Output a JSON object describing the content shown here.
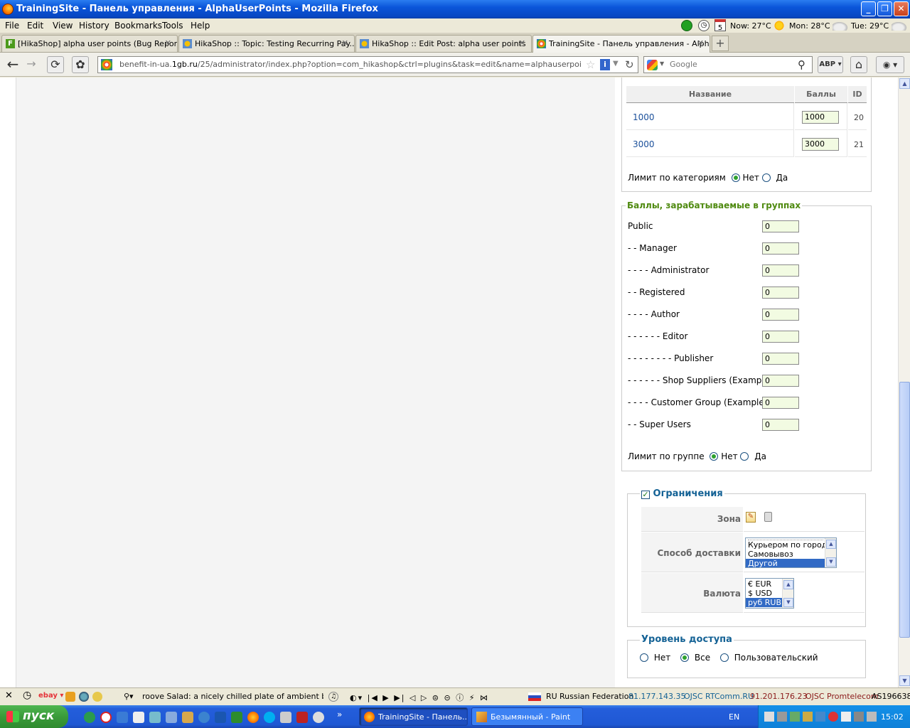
{
  "window": {
    "title": "TrainingSite - Панель управления - AlphaUserPoints - Mozilla Firefox"
  },
  "menu": {
    "items": [
      "File",
      "Edit",
      "View",
      "History",
      "Bookmarks",
      "Tools",
      "Help"
    ]
  },
  "weather": {
    "now": "Now: 27°C",
    "mon": "Mon: 28°C",
    "tue": "Tue: 29°C",
    "calendar_day": "5"
  },
  "tabs": [
    {
      "label": "[HikaShop] alpha user points (Bug Report)",
      "active": false
    },
    {
      "label": "HikaShop :: Topic: Testing Recurring Pay...",
      "active": false
    },
    {
      "label": "HikaShop :: Edit Post: alpha user points",
      "active": false
    },
    {
      "label": "TrainingSite - Панель управления - Alph...",
      "active": true
    }
  ],
  "nav": {
    "url_host": "benefit-in-ua.1gb.ru",
    "url_prefix": "benefit-in-ua.",
    "url_domain": "1gb.ru",
    "url_path": "/25/administrator/index.php?option=com_hikashop&ctrl=plugins&task=edit&name=alphauserpoints&plugin_type=p",
    "search_placeholder": "Google"
  },
  "points_table": {
    "col_name": "Название",
    "col_points": "Баллы",
    "col_id": "ID",
    "rows": [
      {
        "name": "1000",
        "points": "1000",
        "id": "20"
      },
      {
        "name": "3000",
        "points": "3000",
        "id": "21"
      }
    ],
    "limit_label": "Лимит по категориям",
    "limit_no": "Нет",
    "limit_yes": "Да"
  },
  "groups": {
    "legend": "Баллы, зарабатываемые в группах",
    "rows": [
      {
        "label": "Public",
        "value": "0"
      },
      {
        "label": "- - Manager",
        "value": "0"
      },
      {
        "label": "- - - - Administrator",
        "value": "0"
      },
      {
        "label": "- - Registered",
        "value": "0"
      },
      {
        "label": "- - - - Author",
        "value": "0"
      },
      {
        "label": "- - - - - - Editor",
        "value": "0"
      },
      {
        "label": "- - - - - - - - Publisher",
        "value": "0"
      },
      {
        "label": "- - - - - - Shop Suppliers (Example)",
        "value": "0"
      },
      {
        "label": "- - - - Customer Group (Example)",
        "value": "0"
      },
      {
        "label": "- - Super Users",
        "value": "0"
      }
    ],
    "limit_label": "Лимит по группе",
    "limit_no": "Нет",
    "limit_yes": "Да"
  },
  "restrictions": {
    "legend": "Ограничения",
    "zone_label": "Зона",
    "shipping_label": "Способ доставки",
    "shipping_options": [
      "Курьером по городу",
      "Самовывоз",
      "Другой"
    ],
    "shipping_selected": "Другой",
    "currency_label": "Валюта",
    "currency_options": [
      "€ EUR",
      "$ USD",
      "руб RUB"
    ],
    "currency_selected": "руб RUB"
  },
  "access": {
    "legend": "Уровень доступа",
    "opt_none": "Нет",
    "opt_all": "Все",
    "opt_custom": "Пользовательский",
    "selected": "Все"
  },
  "statusbar": {
    "ticker": "roove Salad: a nicely chilled plate of ambient beats a",
    "country_code": "RU",
    "country": "Russian Federation",
    "ip1": "81.177.143.35",
    "org1": "OJSC RTComm.RU",
    "ip2": "91.201.176.23",
    "org2": "OJSC Promtelecom",
    "as": "AS196638"
  },
  "taskbar": {
    "start": "пуск",
    "items": [
      {
        "label": "TrainingSite - Панель...",
        "active": true
      },
      {
        "label": "Безымянный - Paint",
        "active": false
      }
    ],
    "lang": "EN",
    "clock": "15:02"
  },
  "colors": {
    "accent_green": "#4f8a10",
    "accent_blue": "#146295",
    "input_bg": "#f2fbe2"
  }
}
